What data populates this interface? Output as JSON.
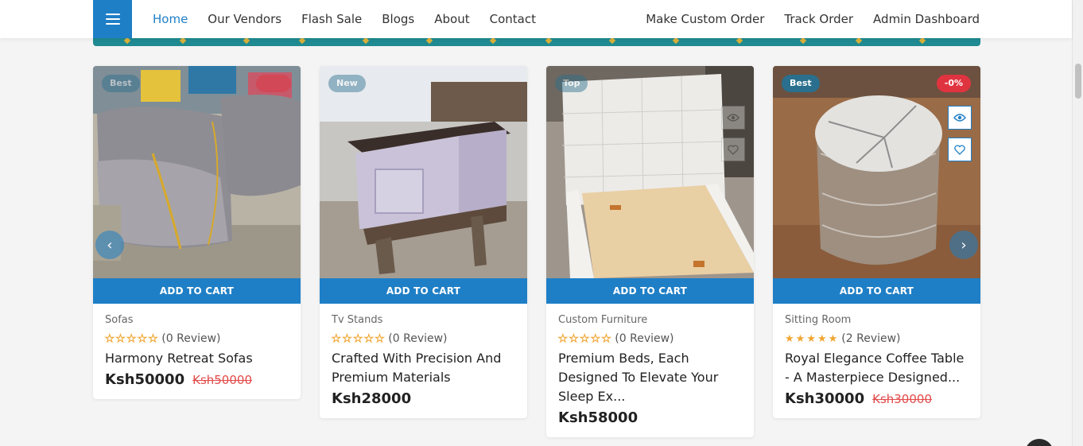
{
  "nav": {
    "left": [
      "Home",
      "Our Vendors",
      "Flash Sale",
      "Blogs",
      "About",
      "Contact"
    ],
    "right": [
      "Make Custom Order",
      "Track Order",
      "Admin Dashboard"
    ]
  },
  "products": [
    {
      "badge_left": "Best",
      "badge_right": "",
      "add_to_cart": "ADD TO CART",
      "category": "Sofas",
      "rating": 0,
      "reviews": "(0 Review)",
      "name": "Harmony Retreat Sofas",
      "price": "Ksh50000",
      "old_price": "Ksh50000"
    },
    {
      "badge_left": "New",
      "badge_right": "",
      "add_to_cart": "ADD TO CART",
      "category": "Tv Stands",
      "rating": 0,
      "reviews": "(0 Review)",
      "name": "Crafted With Precision And Premium Materials",
      "price": "Ksh28000",
      "old_price": ""
    },
    {
      "badge_left": "Top",
      "badge_right": "",
      "add_to_cart": "ADD TO CART",
      "category": "Custom Furniture",
      "rating": 0,
      "reviews": "(0 Review)",
      "name": "Premium Beds, Each Designed To Elevate Your Sleep Ex...",
      "price": "Ksh58000",
      "old_price": ""
    },
    {
      "badge_left": "Best",
      "badge_right": "-0%",
      "add_to_cart": "ADD TO CART",
      "category": "Sitting Room",
      "rating": 5,
      "reviews": "(2 Review)",
      "name": "Royal Elegance Coffee Table - A Masterpiece Designed...",
      "price": "Ksh30000",
      "old_price": "Ksh30000"
    }
  ],
  "icons": {
    "menu": "hamburger-icon",
    "quick_view": "eye-icon",
    "wishlist": "heart-icon",
    "prev": "chevron-left-icon",
    "next": "chevron-right-icon",
    "star": "star-icon"
  },
  "colors": {
    "primary": "#1f7fc6",
    "sale": "#e03340",
    "star": "#f0a531",
    "old_price": "#e34b4b"
  }
}
